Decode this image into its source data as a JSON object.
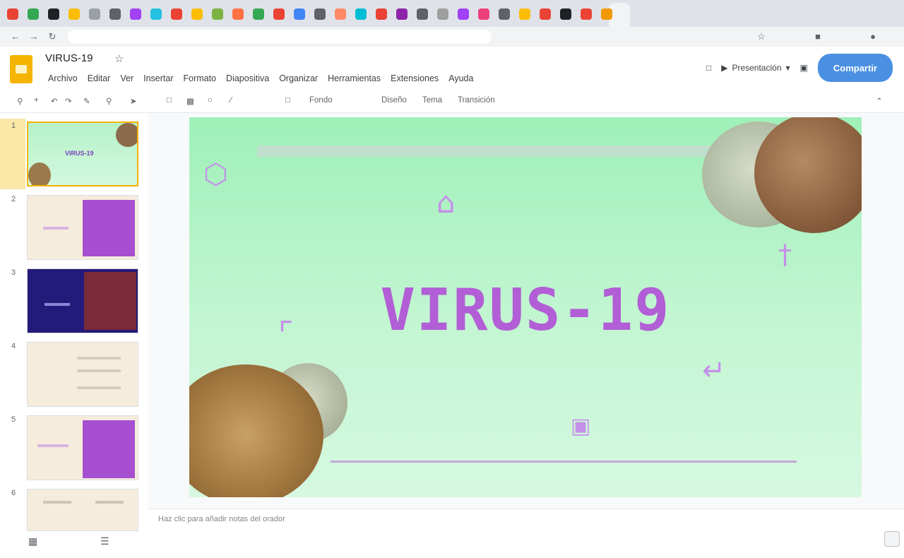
{
  "browser": {
    "tab_colors": [
      "#ea4335",
      "#34a853",
      "#202124",
      "#fbbc04",
      "#9aa0a6",
      "#5f6368",
      "#a142f4",
      "#24c1e0",
      "#ea4335",
      "#fbbc04",
      "#7cb342",
      "#ff7043",
      "#34a853",
      "#ea4335",
      "#4285f4",
      "#5f6368",
      "#ff8a65",
      "#00bcd4",
      "#ea4335",
      "#8e24aa",
      "#5f6368",
      "#9e9e9e",
      "#a142f4",
      "#ec407a",
      "#5f6368",
      "#fbbc04",
      "#ea4335",
      "#202124",
      "#ea4335",
      "#f29900"
    ],
    "url": ""
  },
  "app": {
    "doc_title": "VIRUS-19",
    "menu": [
      "Archivo",
      "Editar",
      "Ver",
      "Insertar",
      "Formato",
      "Diapositiva",
      "Organizar",
      "Herramientas",
      "Extensiones",
      "Ayuda"
    ],
    "slideshow_label": "Presentación",
    "share_label": "Compartir",
    "brand_color": "#f4b400",
    "share_color": "#4a90e2"
  },
  "toolbar": {
    "items": [
      "Fondo",
      "Diseño",
      "Tema",
      "Transición"
    ]
  },
  "filmstrip": {
    "slides": [
      {
        "num": "1",
        "label": "VIRUS-19",
        "selected": true
      },
      {
        "num": "2",
        "label": "",
        "selected": false
      },
      {
        "num": "3",
        "label": "",
        "selected": false
      },
      {
        "num": "4",
        "label": "",
        "selected": false
      },
      {
        "num": "5",
        "label": "",
        "selected": false
      },
      {
        "num": "6",
        "label": "",
        "selected": false
      }
    ]
  },
  "slide": {
    "title": "VIRUS-19",
    "background_color": "#b5f2c8",
    "title_color": "#b25ed6"
  },
  "notes": {
    "placeholder": "Haz clic para añadir notas del orador"
  }
}
